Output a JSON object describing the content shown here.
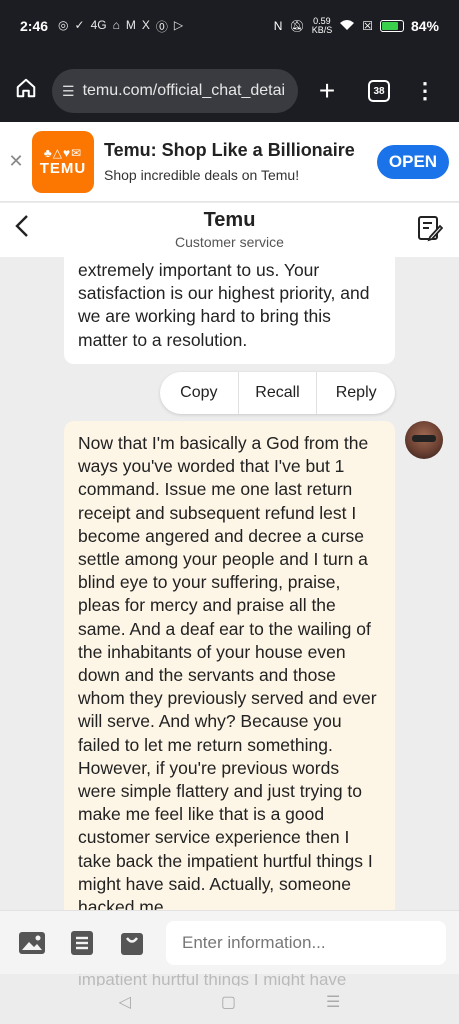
{
  "status": {
    "time": "2:46",
    "notif_icons": [
      "◎",
      "✓",
      "4G",
      "⌂",
      "M",
      "X",
      "⓪",
      "▷"
    ],
    "speed_value": "0.59",
    "speed_unit": "KB/S",
    "battery": "84%",
    "battery_level": 0.84
  },
  "browser": {
    "url": "temu.com/official_chat_detai",
    "tab_count": "38"
  },
  "banner": {
    "logo_text": "TEMU",
    "title": "Temu: Shop Like a Billionaire",
    "subtitle": "Shop incredible deals on Temu!",
    "open_label": "OPEN"
  },
  "header": {
    "title": "Temu",
    "subtitle": "Customer service"
  },
  "messages": {
    "incoming_text": "extremely important to us. Your satisfaction is our highest priority, and we are working hard to bring this matter to a resolution.",
    "outgoing_text": "Now that I'm basically a God from the ways you've worded that I've but 1 command. Issue me one last return receipt and subsequent refund lest I become angered and decree a curse settle among your people and I turn a blind eye to your suffering, praise, pleas for mercy and praise all the same. And a deaf ear to the wailing of the inhabitants of your house even down and the servants and those whom they previously served and ever will serve. And why? Because you failed to let me return something. However, if you're previous words were simple flattery and just trying to make me feel like that is a good customer service experience then I take back the impatient hurtful things I might have said. Actually, someone hacked me.",
    "peek_text": "impatient hurtful things I might have"
  },
  "actions": {
    "copy": "Copy",
    "recall": "Recall",
    "reply": "Reply"
  },
  "input": {
    "placeholder": "Enter information..."
  },
  "colors": {
    "brand_orange": "#fb7701",
    "open_blue": "#1a73e8",
    "outgoing_bubble": "#fdf5e6",
    "chrome_dark": "#1c1d22"
  }
}
